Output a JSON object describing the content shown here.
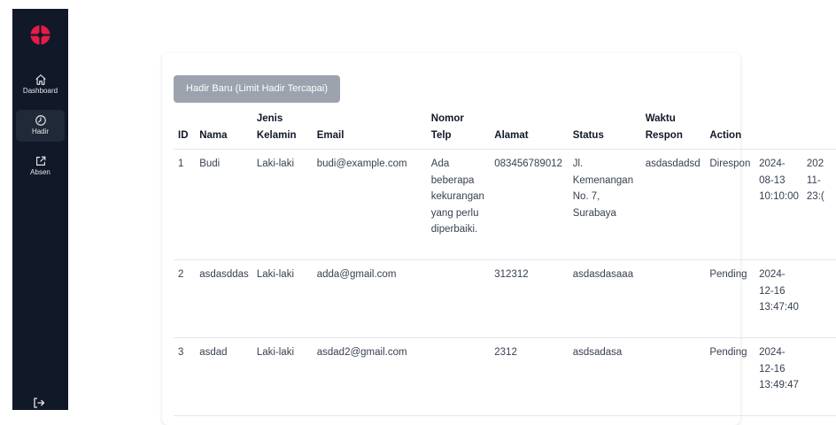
{
  "sidebar": {
    "logo": "logo-icon",
    "items": [
      {
        "label": "Dashboard",
        "icon": "home-icon",
        "active": false
      },
      {
        "label": "Hadir",
        "icon": "clock-icon",
        "active": true
      },
      {
        "label": "Absen",
        "icon": "external-link-icon",
        "active": false
      }
    ],
    "logout_icon": "logout-icon"
  },
  "main": {
    "new_button_label": "Hadir Baru (Limit Hadir Tercapai)",
    "table": {
      "headers": [
        {
          "line1": "",
          "line2": "ID"
        },
        {
          "line1": "",
          "line2": "Nama"
        },
        {
          "line1": "Jenis",
          "line2": "Kelamin"
        },
        {
          "line1": "",
          "line2": "Email"
        },
        {
          "line1": "Nomor",
          "line2": "Telp"
        },
        {
          "line1": "",
          "line2": "Alamat"
        },
        {
          "line1": "",
          "line2": "Status"
        },
        {
          "line1": "Waktu",
          "line2": "Respon"
        },
        {
          "line1": "",
          "line2": "Action"
        }
      ],
      "rows": [
        {
          "id": "1",
          "nama": "Budi",
          "jenis_kelamin": "Laki-laki",
          "email": "budi@example.com",
          "keterangan": "Ada beberapa kekurangan yang perlu diperbaiki.",
          "nomor_telp": "083456789012",
          "alamat": "Jl. Kemenangan No. 7, Surabaya",
          "catatan": "asdasdadsd",
          "status": "Direspon",
          "waktu": [
            "2024-",
            "08-13",
            "10:10:00"
          ],
          "waktu_respon": [
            "202",
            "11-",
            "23:("
          ]
        },
        {
          "id": "2",
          "nama": "asdasddas",
          "jenis_kelamin": "Laki-laki",
          "email": "adda@gmail.com",
          "keterangan": "",
          "nomor_telp": "312312",
          "alamat": "asdasdasaaa",
          "catatan": "",
          "status": "Pending",
          "waktu": [
            "2024-",
            "12-16",
            "13:47:40"
          ],
          "waktu_respon": [
            "",
            "",
            ""
          ]
        },
        {
          "id": "3",
          "nama": "asdad",
          "jenis_kelamin": "Laki-laki",
          "email": "asdad2@gmail.com",
          "keterangan": "",
          "nomor_telp": "2312",
          "alamat": "asdsadasa",
          "catatan": "",
          "status": "Pending",
          "waktu": [
            "2024-",
            "12-16",
            "13:49:47"
          ],
          "waktu_respon": [
            "",
            "",
            ""
          ]
        }
      ]
    }
  }
}
